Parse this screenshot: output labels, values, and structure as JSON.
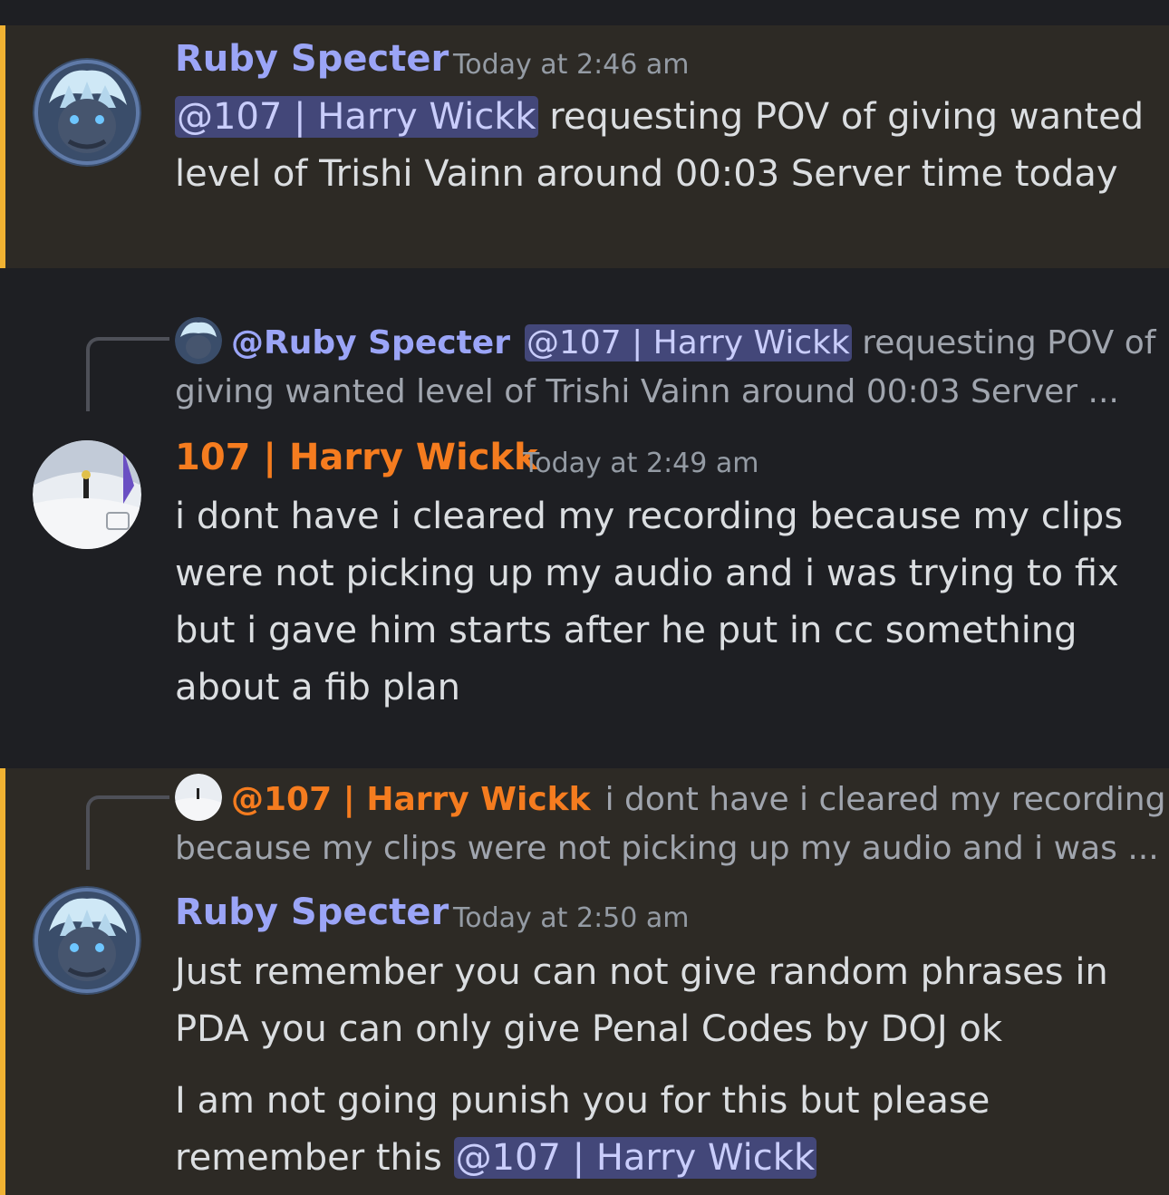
{
  "messages": [
    {
      "author": "Ruby Specter",
      "time": "Today at 2:46 am",
      "mention": "@107 | Harry Wickk",
      "text": " requesting POV of giving wanted level of Trishi Vainn around 00:03  Server time today"
    },
    {
      "reply": {
        "author": "@Ruby Specter",
        "mention": "@107 | Harry Wickk",
        "text_line1": " requesting POV of",
        "text_line2": "giving wanted level of Trishi Vainn around 00:03  Server ..."
      },
      "author": "107 | Harry Wickk",
      "time": "Today at 2:49 am",
      "text": "i dont have i cleared my recording because my clips were not picking up my audio and i was trying to fix but i gave him starts after he put in cc something about a fib plan"
    },
    {
      "reply": {
        "author": "@107 | Harry Wickk",
        "text_line1": "i dont have i cleared my recording",
        "text_line2": "because my clips were not picking up my audio and i was ..."
      },
      "author": "Ruby Specter",
      "time": "Today at 2:50 am",
      "text1": "Just remember you can not give random phrases in PDA you can only give Penal Codes by DOJ ok",
      "text2": "I am not going punish you for this but please remember this ",
      "mention": "@107 | Harry Wickk"
    }
  ],
  "colors": {
    "ruby_name": "#9ba5f7",
    "harry_name": "#f57c1f",
    "highlight_bar": "#f0b232"
  },
  "icons": {
    "ruby_avatar": "anime-avatar-icon",
    "harry_avatar": "snow-skier-avatar-icon"
  }
}
